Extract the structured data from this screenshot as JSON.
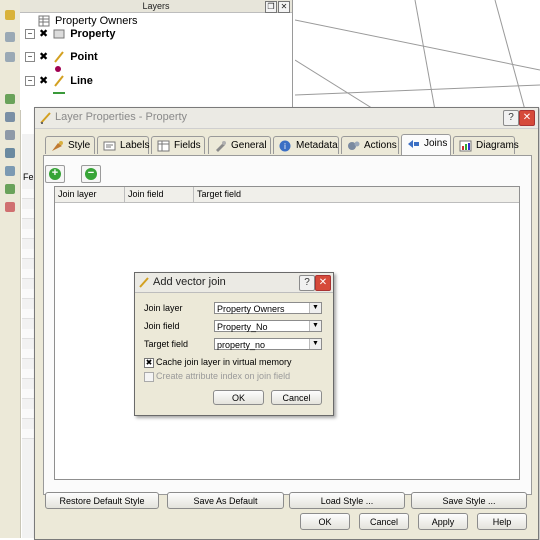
{
  "layers_panel": {
    "title": "Layers",
    "layers": [
      {
        "name": "Property Owners"
      },
      {
        "name": "Property"
      },
      {
        "name": "Point"
      },
      {
        "name": "Line"
      }
    ]
  },
  "layer_properties": {
    "title": "Layer Properties - Property",
    "help_button": "?",
    "tabs": [
      {
        "label": "Style",
        "icon": "style-icon"
      },
      {
        "label": "Labels",
        "icon": "labels-icon"
      },
      {
        "label": "Fields",
        "icon": "fields-icon"
      },
      {
        "label": "General",
        "icon": "general-icon"
      },
      {
        "label": "Metadata",
        "icon": "metadata-icon"
      },
      {
        "label": "Actions",
        "icon": "actions-icon"
      },
      {
        "label": "Joins",
        "icon": "joins-icon"
      },
      {
        "label": "Diagrams",
        "icon": "diagrams-icon"
      }
    ],
    "active_tab": "Joins",
    "join_table": {
      "columns": [
        "Join layer",
        "Join field",
        "Target field"
      ]
    },
    "bottom_buttons": {
      "restore_default": "Restore Default Style",
      "save_as_default": "Save As Default",
      "load_style": "Load Style ...",
      "save_style": "Save Style ..."
    },
    "dialog_buttons": {
      "ok": "OK",
      "cancel": "Cancel",
      "apply": "Apply",
      "help": "Help"
    }
  },
  "add_vector_join": {
    "title": "Add vector join",
    "help_button": "?",
    "fields": {
      "join_layer": {
        "label": "Join layer",
        "value": "Property Owners"
      },
      "join_field": {
        "label": "Join field",
        "value": "Property_No"
      },
      "target_field": {
        "label": "Target field",
        "value": "property_no"
      }
    },
    "cache_join_layer": {
      "label": "Cache join layer in virtual memory",
      "checked": true
    },
    "create_index": {
      "label": "Create attribute index on join field",
      "checked": false,
      "enabled": false
    },
    "ok": "OK",
    "cancel": "Cancel"
  },
  "side_panel": {
    "label": "Fe"
  },
  "colors": {
    "point_symbol": "#a00050",
    "line_symbol": "#3a9a3a",
    "close_button": "#d64a3a",
    "add_remove_icon": "#37a437"
  }
}
